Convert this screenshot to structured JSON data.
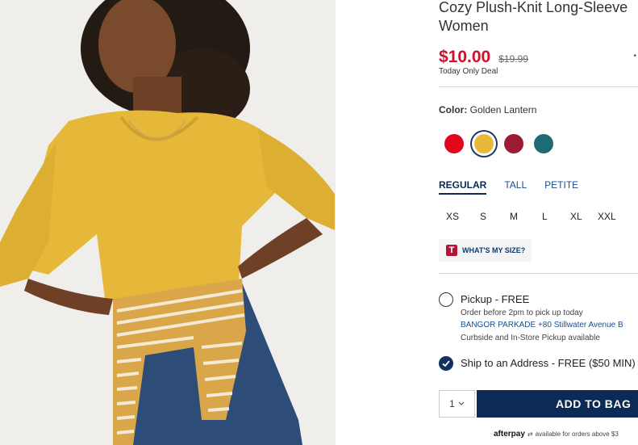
{
  "product": {
    "title_line1": "Cozy Plush-Knit Long-Sleeve",
    "title_line2": "Women",
    "price": "$10.00",
    "old_price": "$19.99",
    "deal_text": "Today Only Deal",
    "edge_mark": "•"
  },
  "color": {
    "label": "Color:",
    "value": "Golden Lantern",
    "swatches": [
      {
        "name": "red",
        "hex": "#e2061c"
      },
      {
        "name": "golden-lantern",
        "hex": "#e8b83a",
        "selected": true
      },
      {
        "name": "burgundy",
        "hex": "#9a1b33"
      },
      {
        "name": "teal",
        "hex": "#1f6b73"
      }
    ]
  },
  "fit_tabs": [
    {
      "label": "REGULAR",
      "active": true
    },
    {
      "label": "TALL",
      "active": false
    },
    {
      "label": "PETITE",
      "active": false
    }
  ],
  "sizes": [
    "XS",
    "S",
    "M",
    "L",
    "XL",
    "XXL"
  ],
  "size_help": {
    "icon": "T",
    "label": "WHAT'S MY SIZE?"
  },
  "fulfillment": {
    "pickup_label": "Pickup - FREE",
    "pickup_note": "Order before 2pm to pick up today",
    "store": "BANGOR PARKADE +80 Stillwater Avenue  B",
    "curbside": "Curbside and In-Store Pickup available",
    "ship_label": "Ship to an Address - FREE ($50 MIN)"
  },
  "cart": {
    "qty": "1",
    "qty_icon": "chevron-down-icon",
    "add_label": "ADD TO BAG"
  },
  "afterpay": {
    "logo": "afterpay",
    "text": "available for orders above $3"
  }
}
